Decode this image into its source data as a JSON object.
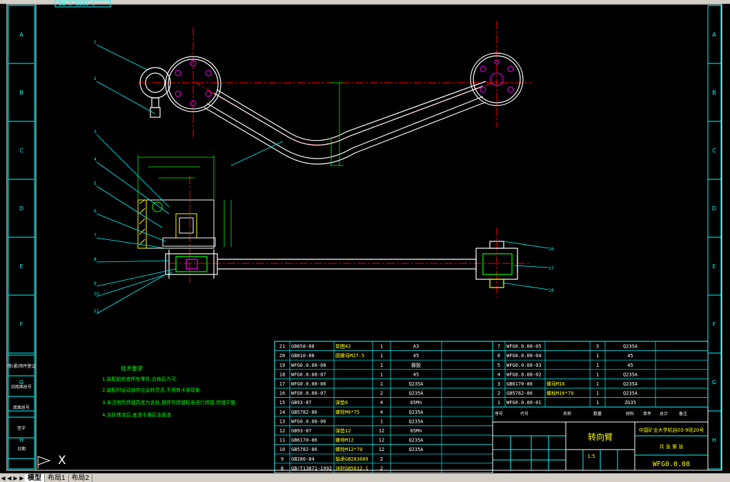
{
  "layout_tabs": [
    {
      "label": "模型",
      "active": true
    },
    {
      "label": "布局1",
      "active": false
    },
    {
      "label": "布局2",
      "active": false
    }
  ],
  "top_snippet": "00 0 0331 1",
  "zone_letters_left": [
    "A",
    "B",
    "C",
    "D",
    "E",
    "F",
    "G",
    "H"
  ],
  "zone_letters_right": [
    "A",
    "B",
    "C",
    "D",
    "E",
    "F",
    "G",
    "H"
  ],
  "side_labels": [
    "借(通)用件登记",
    "旧底图总号",
    "底图总号",
    "签字",
    "日期"
  ],
  "part_balloons_left": [
    "1",
    "2",
    "3",
    "4",
    "5",
    "6",
    "7",
    "8",
    "9",
    "10",
    "11"
  ],
  "part_balloons_right": [
    "16",
    "17",
    "18"
  ],
  "tech_req": {
    "title": "技术要求",
    "lines": [
      "1.装配前检查所有零件,合格后方可.",
      "2.装配时运动部件应运转灵活,不得有卡滞现象.",
      "3.未注明的焊缝高度为该处,按焊件焊缝标准进行焊接,焊缝平整.",
      "4.涂防锈漆后,底漆干燥后涂面漆."
    ]
  },
  "bom_left": [
    [
      "21",
      "GB858-88",
      "垫圈42",
      "1",
      "A3"
    ],
    [
      "20",
      "GB810-88",
      "圆螺母M27.5",
      "1",
      "45"
    ],
    [
      "19",
      "WFG0.0.08-08",
      "",
      "1",
      "橡胶"
    ],
    [
      "18",
      "WFG0.0.08-07",
      "",
      "1",
      "45"
    ],
    [
      "17",
      "WFG0.0.08-06",
      "",
      "1",
      "Q235A"
    ],
    [
      "16",
      "WFG0.0.08-07",
      "",
      "2",
      "Q235A"
    ],
    [
      "15",
      "GB93-87",
      "弹垫6",
      "4",
      "65Mn"
    ],
    [
      "14",
      "GB5782-86",
      "螺栓M6*75",
      "4",
      "Q235A"
    ],
    [
      "13",
      "WFG0.0.08-06",
      "",
      "1",
      "Q235A"
    ],
    [
      "12",
      "GB93-87",
      "弹垫12",
      "12",
      "65Mn"
    ],
    [
      "11",
      "GB6170-86",
      "螺母M12",
      "12",
      "Q235A"
    ],
    [
      "10",
      "GB5782-86",
      "螺栓M12*70",
      "12",
      "Q235A"
    ],
    [
      "9",
      "GB286-84",
      "轴承GB283689",
      "2",
      ""
    ],
    [
      "8",
      "GB/T13871-1992",
      "油封GB5012.1",
      "2",
      ""
    ]
  ],
  "bom_right": [
    [
      "7",
      "WFG0.0.08-05",
      "",
      "3",
      "Q235A"
    ],
    [
      "6",
      "WFG0.0.08-04",
      "",
      "1",
      "45"
    ],
    [
      "5",
      "WFG0.0.08-03",
      "",
      "1",
      "45"
    ],
    [
      "4",
      "WFG0.0.08-02",
      "",
      "1",
      "Q235A"
    ],
    [
      "3",
      "GB6170-86",
      "螺母M16",
      "1",
      "Q235A"
    ],
    [
      "2",
      "GB5782-86",
      "螺栓M16*70",
      "1",
      "Q235A"
    ],
    [
      "1",
      "WFG0.0.08-01",
      "",
      "1",
      "ZG35"
    ]
  ],
  "bom_header": [
    "序号",
    "代号",
    "名称",
    "数量",
    "材料",
    "单件",
    "总计",
    "备注"
  ],
  "title_block": {
    "part_name": "转向臂",
    "school": "中国矿业大学机自03-9班20号",
    "drawing_no": "WFG0.0.08",
    "scale": "1:5",
    "sheet": "共 张 第 张"
  },
  "command_prompt": "X"
}
